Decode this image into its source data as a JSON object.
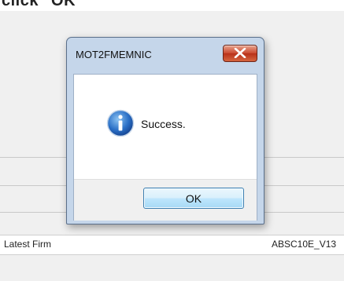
{
  "caption": {
    "text": "click \"OK\""
  },
  "background": {
    "row_label": "Latest Firm",
    "row_value": "ABSC10E_V13"
  },
  "dialog": {
    "title": "MOT2FMEMNIC",
    "message": "Success.",
    "ok_label": "OK",
    "icon": "info-icon",
    "close_icon": "close-icon"
  },
  "colors": {
    "close_button": "#c9482f",
    "ok_button_border": "#3c7fb1",
    "info_icon": "#2a6fc6",
    "dialog_frame": "#c5d6ea"
  }
}
